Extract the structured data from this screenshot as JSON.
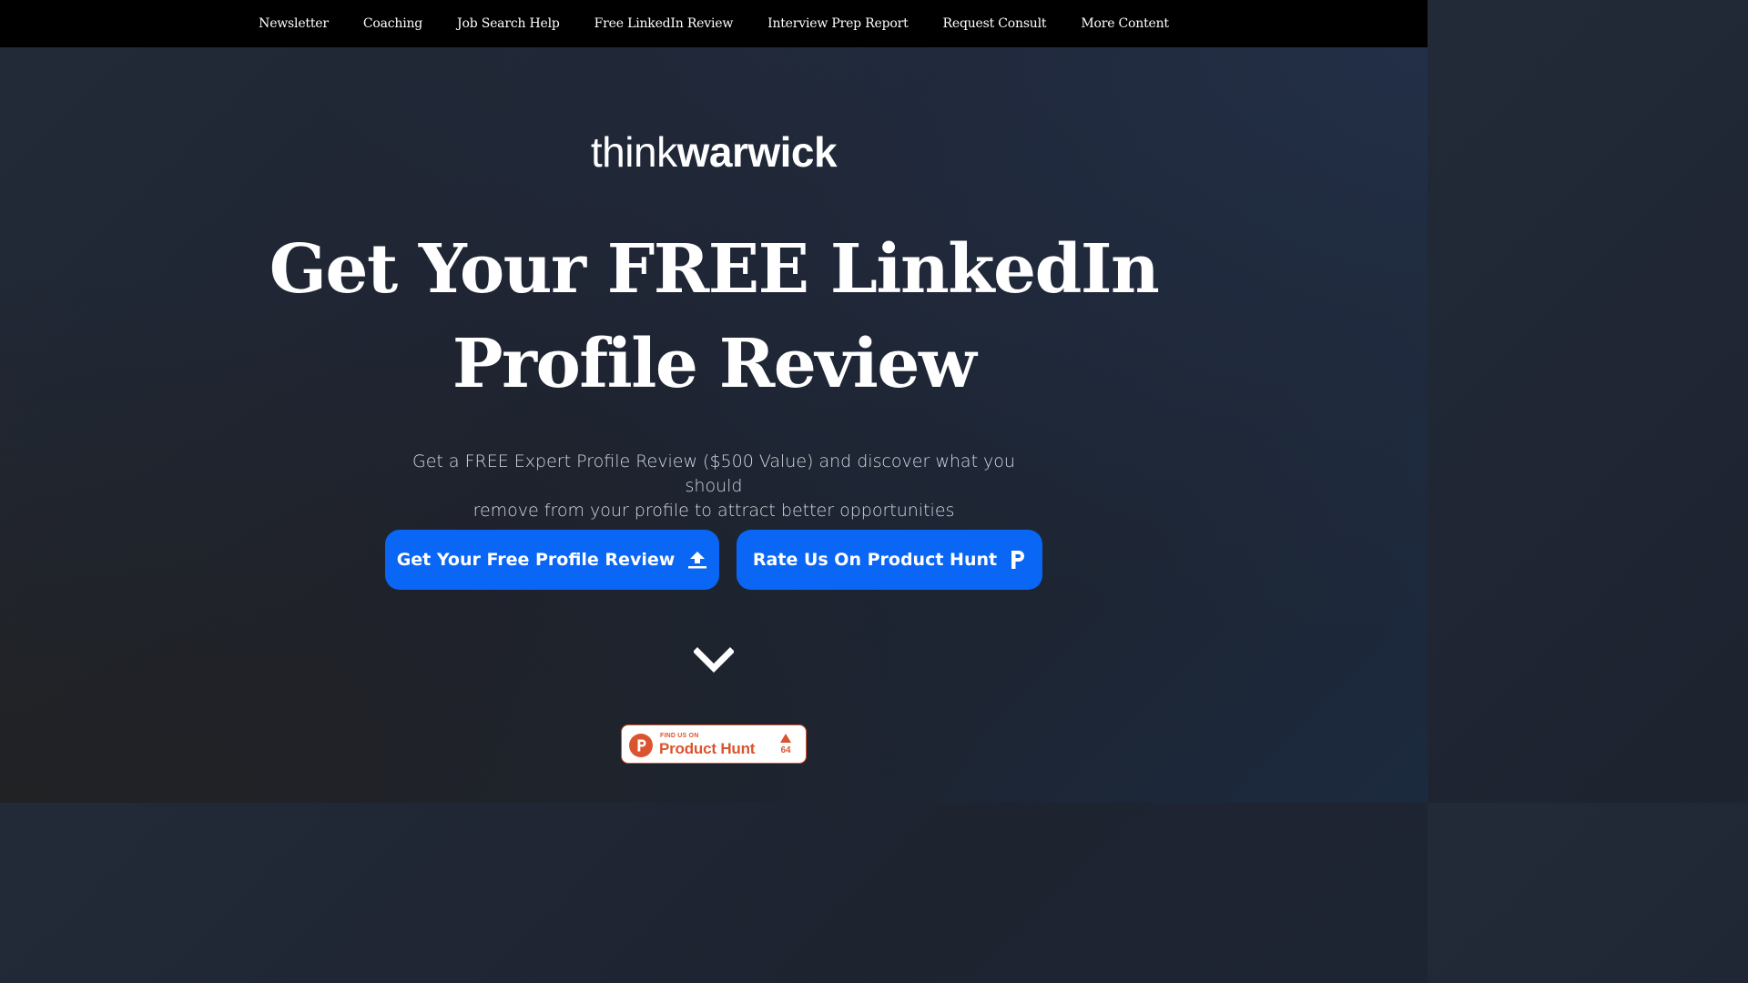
{
  "nav": {
    "items": [
      {
        "label": "Newsletter"
      },
      {
        "label": "Coaching"
      },
      {
        "label": "Job Search Help"
      },
      {
        "label": "Free LinkedIn Review"
      },
      {
        "label": "Interview Prep Report"
      },
      {
        "label": "Request Consult"
      },
      {
        "label": "More Content"
      }
    ]
  },
  "logo": {
    "light": "think",
    "bold": "warwick"
  },
  "hero": {
    "headline_line1": "Get Your FREE LinkedIn",
    "headline_line2": "Profile Review",
    "subtext_line1": "Get a FREE Expert Profile Review ($500 Value) and discover what you should",
    "subtext_line2": "remove from your profile to attract better opportunities"
  },
  "buttons": {
    "review_label": "Get Your Free Profile Review",
    "review_icon": "upload-icon",
    "ph_label": "Rate Us On Product Hunt",
    "ph_icon": "product-hunt-p-icon"
  },
  "scroll": {
    "icon": "chevron-down-icon"
  },
  "product_hunt_badge": {
    "small_text": "FIND US ON",
    "big_text": "Product Hunt",
    "vote_count": "64",
    "logo_letter": "P"
  },
  "colors": {
    "nav_bg": "#000000",
    "accent_blue": "#0a66f5",
    "product_hunt": "#da552f"
  }
}
